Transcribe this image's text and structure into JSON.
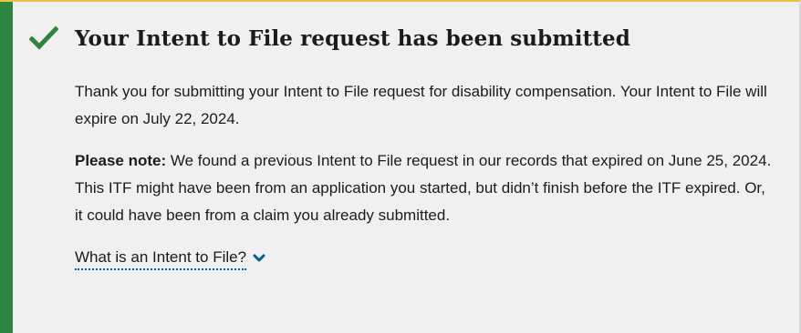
{
  "alert": {
    "title": "Your Intent to File request has been submitted",
    "status_color": "#2e8540",
    "icon": "checkmark-icon"
  },
  "body": {
    "paragraph_1": "Thank you for submitting your Intent to File request for disability compensation. Your Intent to File will expire on July 22, 2024.",
    "note_label": "Please note:",
    "note_text": " We found a previous Intent to File request in our records that expired on June 25, 2024. This ITF might have been from an application you started, but didn’t finish before the ITF expired. Or, it could have been from a claim you already submitted."
  },
  "expander": {
    "label": "What is an Intent to File?",
    "icon": "chevron-down-icon",
    "link_color": "#005ea2"
  }
}
